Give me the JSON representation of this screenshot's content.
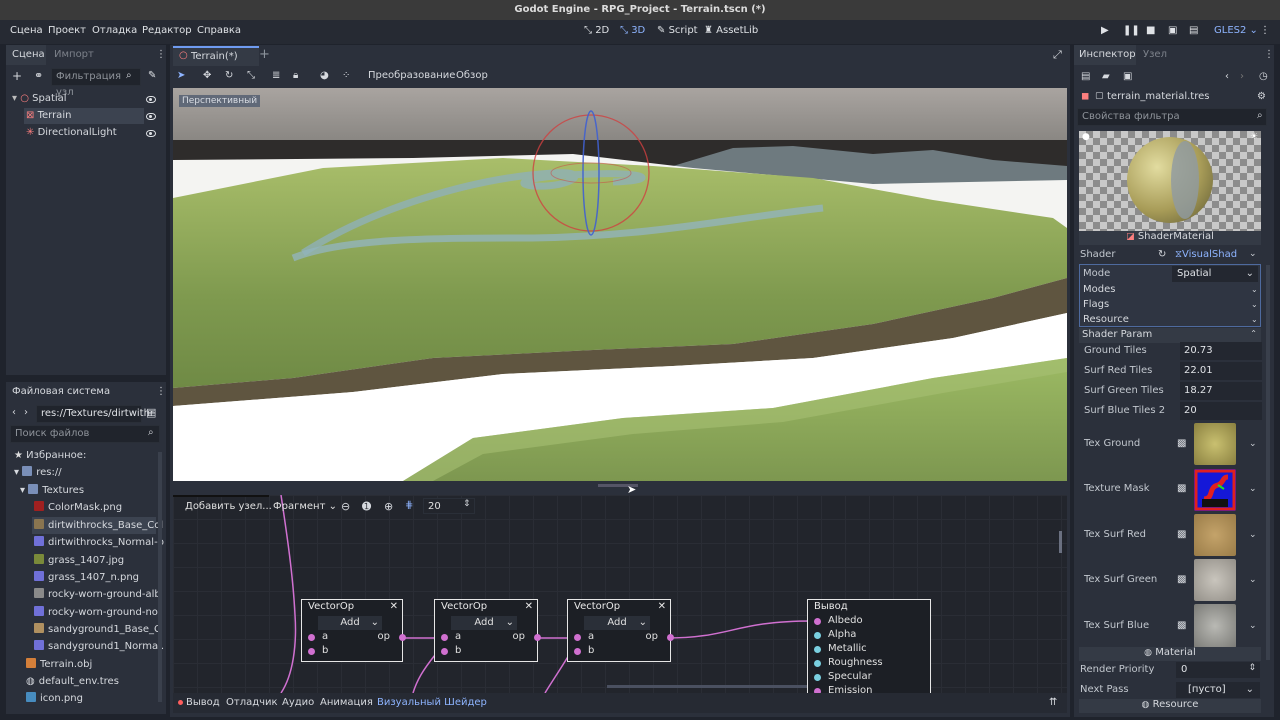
{
  "window_title": "Godot Engine - RPG_Project - Terrain.tscn (*)",
  "menu": [
    "Сцена",
    "Проект",
    "Отладка",
    "Редактор",
    "Справка"
  ],
  "workspaces": {
    "w2d": "2D",
    "w3d": "3D",
    "script": "Script",
    "assetlib": "AssetLib"
  },
  "renderer": "GLES2",
  "scene_dock": {
    "tab_scene": "Сцена",
    "tab_import": "Импорт",
    "filter_placeholder": "Фильтрация узл",
    "nodes": [
      {
        "name": "Spatial",
        "icon": "spatial-node-icon"
      },
      {
        "name": "Terrain",
        "icon": "mesh-instance-icon"
      },
      {
        "name": "DirectionalLight",
        "icon": "light-icon"
      }
    ]
  },
  "filesystem": {
    "title": "Файловая система",
    "path": "res://Textures/dirtwithr",
    "search_placeholder": "Поиск файлов",
    "favorites": "Избранное:",
    "root": "res://",
    "folder": "Textures",
    "files": [
      "ColorMask.png",
      "dirtwithrocks_Base_Col",
      "dirtwithrocks_Normal-o",
      "grass_1407.jpg",
      "grass_1407_n.png",
      "rocky-worn-ground-alb",
      "rocky-worn-ground-nor",
      "sandyground1_Base_C",
      "sandyground1_Normal."
    ],
    "root_files": [
      "Terrain.obj",
      "default_env.tres",
      "icon.png"
    ]
  },
  "editor_tab": {
    "label": "Terrain(*)"
  },
  "viewport_toolbar": {
    "transform": "Преобразование",
    "view": "Обзор"
  },
  "viewport_label": "Перспективный",
  "graph_toolbar": {
    "add_node": "Добавить узел...",
    "mode": "Фрагмент",
    "zoom": "20"
  },
  "nodes": [
    {
      "title": "VectorOp",
      "op": "Add",
      "in_a": "a",
      "in_b": "b",
      "out": "op"
    },
    {
      "title": "VectorOp",
      "op": "Add",
      "in_a": "a",
      "in_b": "b",
      "out": "op"
    },
    {
      "title": "VectorOp",
      "op": "Add",
      "in_a": "a",
      "in_b": "b",
      "out": "op"
    }
  ],
  "output_node": {
    "title": "Вывод",
    "ports": [
      "Albedo",
      "Alpha",
      "Metallic",
      "Roughness",
      "Specular",
      "Emission"
    ]
  },
  "bottom_tabs": [
    "Вывод",
    "Отладчик",
    "Аудио",
    "Анимация",
    "Визуальный Шейдер"
  ],
  "inspector": {
    "tab_inspector": "Инспектор",
    "tab_node": "Узел",
    "resource": "terrain_material.tres",
    "filter_placeholder": "Свойства фильтра",
    "material_type": "ShaderMaterial",
    "shader_label": "Shader",
    "shader_value": "VisualShad",
    "mode_label": "Mode",
    "mode_value": "Spatial",
    "modes": "Modes",
    "flags": "Flags",
    "resource_section": "Resource",
    "shader_param": "Shader Param",
    "params": [
      {
        "label": "Ground Tiles",
        "value": "20.73"
      },
      {
        "label": "Surf Red Tiles",
        "value": "22.01"
      },
      {
        "label": "Surf Green Tiles",
        "value": "18.27"
      },
      {
        "label": "Surf Blue Tiles 2",
        "value": "20"
      }
    ],
    "textures": [
      "Tex Ground",
      "Texture Mask",
      "Tex Surf Red",
      "Tex Surf Green",
      "Tex Surf Blue"
    ],
    "material_section": "Material",
    "render_priority_label": "Render Priority",
    "render_priority_value": "0",
    "next_pass_label": "Next Pass",
    "next_pass_value": "[пусто]",
    "resource_footer": "Resource"
  }
}
